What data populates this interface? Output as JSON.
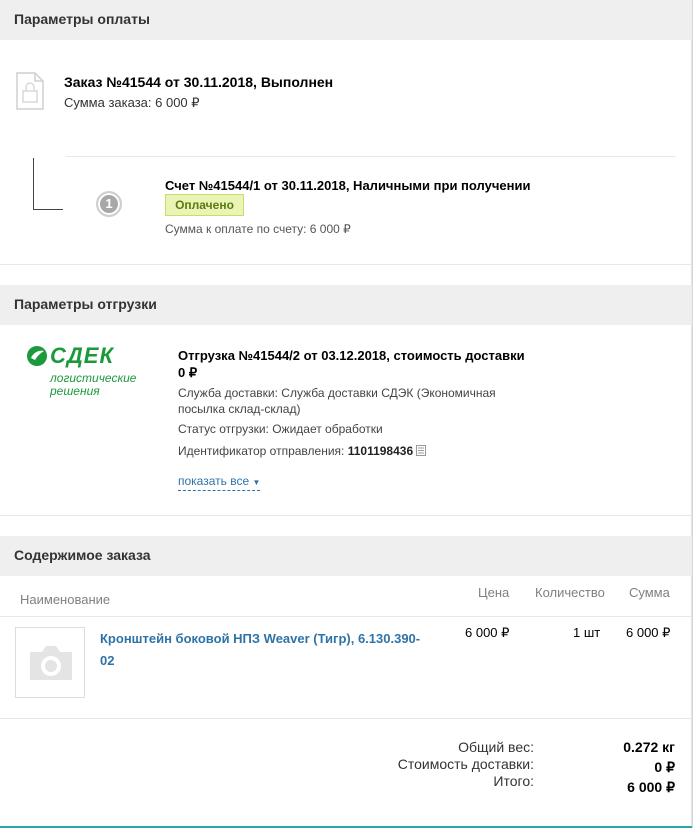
{
  "payment": {
    "section_title": "Параметры оплаты",
    "order_title": "Заказ №41544 от 30.11.2018, Выполнен",
    "order_sum": "Сумма заказа: 6 000 ₽",
    "invoice_title": "Счет №41544/1 от 30.11.2018, Наличными при получении",
    "step_number": "1",
    "paid_badge": "Оплачено",
    "invoice_sum": "Сумма к оплате по счету: 6 000 ₽"
  },
  "shipment": {
    "section_title": "Параметры отгрузки",
    "logo_text": "СДЕК",
    "logo_sub1": "логистические",
    "logo_sub2": "решения",
    "title_line1": "Отгрузка №41544/2 от 03.12.2018, стоимость доставки",
    "title_line2": "0 ₽",
    "service_line1": "Служба доставки: Служба доставки СДЭК (Экономичная",
    "service_line2": "посылка склад-склад)",
    "status": "Статус отгрузки: Ожидает обработки",
    "tracking_label": "Идентификатор отправления:",
    "tracking_id": "1101198436",
    "show_all": "показать все"
  },
  "contents": {
    "section_title": "Содержимое заказа",
    "columns": {
      "name": "Наименование",
      "price": "Цена",
      "qty": "Количество",
      "sum": "Сумма"
    },
    "items": [
      {
        "name_line1": "Кронштейн боковой НПЗ Weaver (Тигр), 6.130.390-",
        "name_line2": "02",
        "price": "6 000 ₽",
        "qty": "1 шт",
        "sum": "6 000 ₽"
      }
    ]
  },
  "totals": {
    "weight_label": "Общий вес:",
    "weight_value": "0.272 кг",
    "delivery_label": "Стоимость доставки:",
    "delivery_value": "0 ₽",
    "total_label": "Итого:",
    "total_value": "6 000 ₽"
  },
  "colors": {
    "accent_link": "#2e73a8",
    "brand_green": "#1a9a3a",
    "paid_bg": "#e9f4b5"
  }
}
